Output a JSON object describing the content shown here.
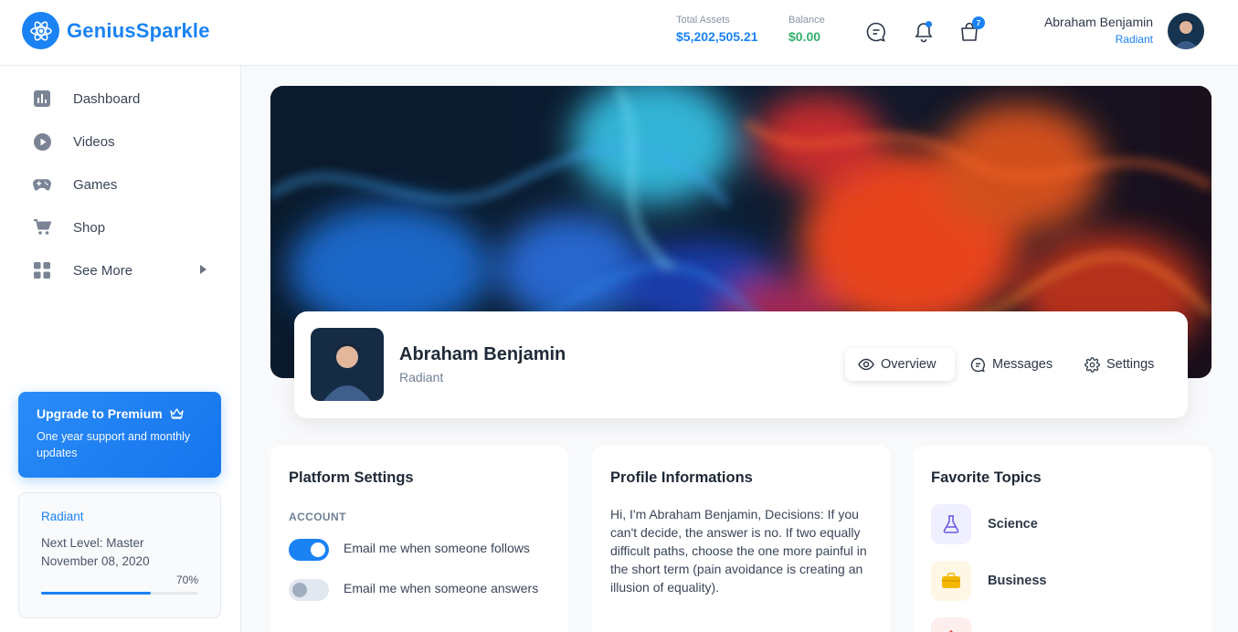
{
  "brand": {
    "name": "GeniusSparkle"
  },
  "header": {
    "total_assets_label": "Total Assets",
    "total_assets_value": "$5,202,505.21",
    "balance_label": "Balance",
    "balance_value": "$0.00",
    "cart_count": "7",
    "user_name": "Abraham Benjamin",
    "user_rank": "Radiant"
  },
  "sidebar": {
    "items": [
      {
        "label": "Dashboard",
        "icon": "chart-icon"
      },
      {
        "label": "Videos",
        "icon": "play-icon"
      },
      {
        "label": "Games",
        "icon": "gamepad-icon"
      },
      {
        "label": "Shop",
        "icon": "cart-icon"
      },
      {
        "label": "See More",
        "icon": "grid-icon"
      }
    ],
    "premium": {
      "title": "Upgrade to Premium",
      "desc": "One year support and monthly updates"
    },
    "level": {
      "rank": "Radiant",
      "next": "Next Level: Master",
      "date": "November 08, 2020",
      "progress_label": "70%",
      "progress": 0.7
    }
  },
  "profile": {
    "name": "Abraham Benjamin",
    "rank": "Radiant",
    "tabs": {
      "overview": "Overview",
      "messages": "Messages",
      "settings": "Settings"
    }
  },
  "platform": {
    "title": "Platform Settings",
    "section": "ACCOUNT",
    "toggles": [
      {
        "label": "Email me when someone follows",
        "on": true
      },
      {
        "label": "Email me when someone answers",
        "on": false
      }
    ]
  },
  "profile_info": {
    "title": "Profile Informations",
    "text": "Hi, I'm Abraham Benjamin, Decisions: If you can't decide, the answer is no. If two equally difficult paths, choose the one more painful in the short term (pain avoidance is creating an illusion of equality)."
  },
  "topics": {
    "title": "Favorite Topics",
    "items": [
      {
        "label": "Science",
        "icon": "flask-icon"
      },
      {
        "label": "Business",
        "icon": "briefcase-icon"
      }
    ]
  },
  "colors": {
    "accent": "#1a82f3",
    "success": "#33b16b"
  }
}
